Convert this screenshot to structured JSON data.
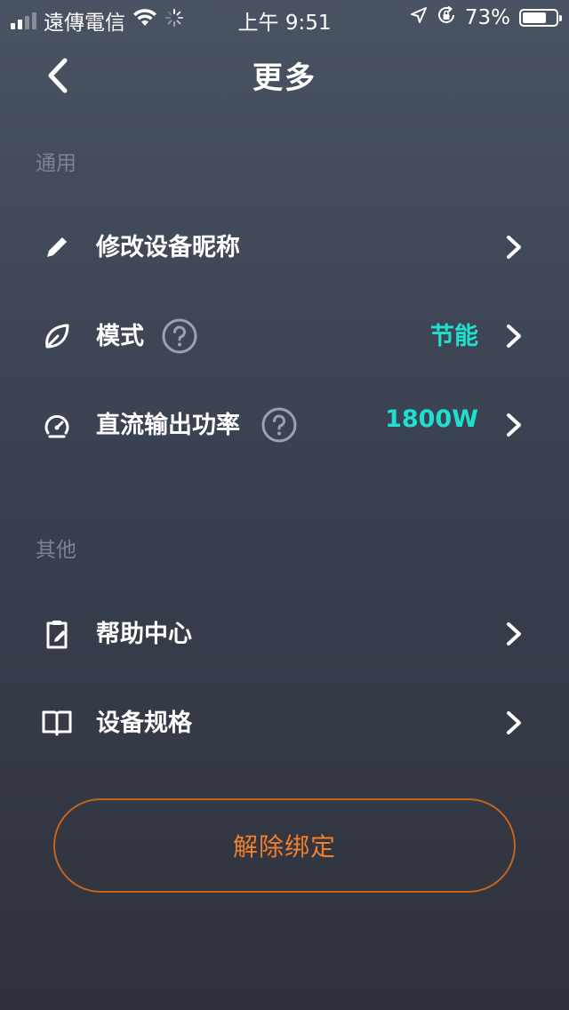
{
  "status_bar": {
    "carrier": "遠傳電信",
    "time": "上午 9:51",
    "battery_percent": "73%",
    "battery_level": 0.73,
    "icons": [
      "signal-icon",
      "wifi-icon",
      "loading-spinner-icon",
      "location-arrow-icon",
      "orientation-lock-icon",
      "battery-icon"
    ]
  },
  "nav": {
    "title": "更多",
    "back_icon": "chevron-left-icon"
  },
  "sections": {
    "general": {
      "header": "通用",
      "items": [
        {
          "label": "修改设备昵称",
          "icon": "pencil-icon",
          "value": ""
        },
        {
          "label": "模式",
          "icon": "leaf-icon",
          "value": "节能",
          "help_icon": "question-circle-icon"
        },
        {
          "label": "直流输出功率",
          "icon": "gauge-icon",
          "value": "1800W",
          "help_icon": "question-circle-icon"
        }
      ]
    },
    "other": {
      "header": "其他",
      "items": [
        {
          "label": "帮助中心",
          "icon": "clipboard-edit-icon",
          "value": ""
        },
        {
          "label": "设备规格",
          "icon": "open-book-icon",
          "value": ""
        }
      ]
    }
  },
  "unbind_button": {
    "label": "解除绑定"
  },
  "colors": {
    "accent_value": "#1fe0cf",
    "danger_text": "#f07f2c",
    "danger_border": "#c2641e",
    "section_header": "#7c8391"
  }
}
